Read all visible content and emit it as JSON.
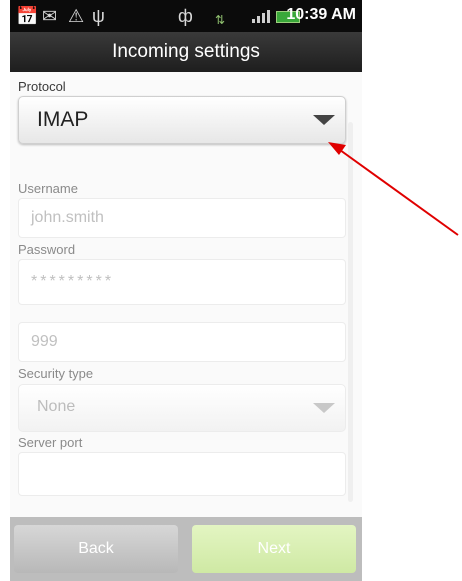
{
  "caption": "Select IMAP",
  "status_bar": {
    "time": "10:39 AM",
    "icons": [
      "calendar-icon",
      "gmail-icon",
      "warning-icon",
      "usb-icon",
      "vibrate-icon",
      "data-icon",
      "signal-icon",
      "battery-icon"
    ]
  },
  "title_bar": {
    "title": "Incoming settings"
  },
  "form": {
    "protocol": {
      "label": "Protocol",
      "value": "IMAP"
    },
    "username": {
      "label": "Username",
      "value": "john.smith"
    },
    "password": {
      "label": "Password",
      "value": "*********"
    },
    "server": {
      "value": "999"
    },
    "security_type": {
      "label": "Security type",
      "value": "None"
    },
    "server_port": {
      "label": "Server port",
      "value": ""
    }
  },
  "buttons": {
    "back": "Back",
    "next": "Next"
  },
  "colors": {
    "title_bar": "#2a2a2a",
    "next_button": "#d6edae",
    "annotation_arrow": "#e00000"
  }
}
